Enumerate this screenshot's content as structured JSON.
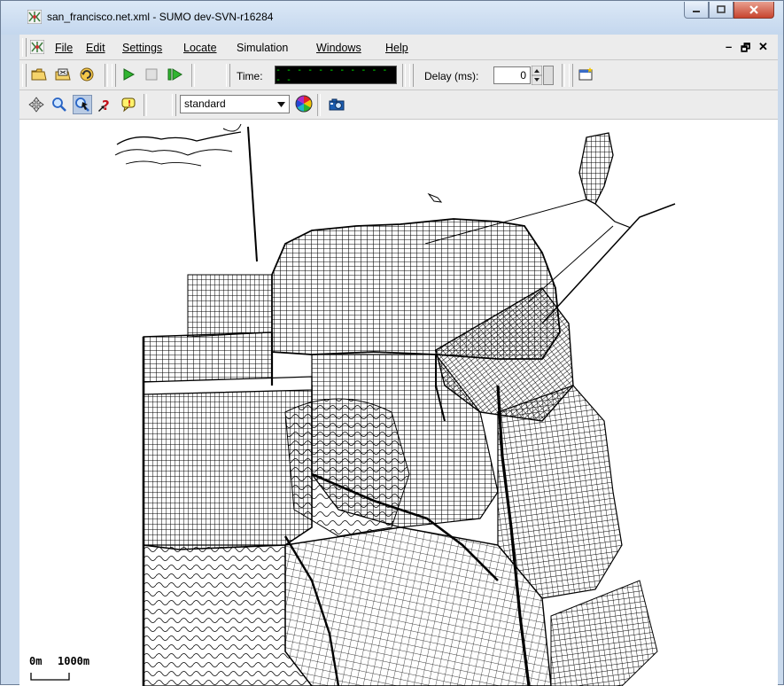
{
  "window": {
    "title": "san_francisco.net.xml - SUMO dev-SVN-r16284",
    "icon": "sumo-app-icon",
    "controls": [
      "minimize-icon",
      "maximize-icon",
      "close-icon"
    ]
  },
  "menubar": {
    "items": [
      {
        "label": "File"
      },
      {
        "label": "Edit"
      },
      {
        "label": "Settings"
      },
      {
        "label": "Locate"
      },
      {
        "label": "Simulation"
      },
      {
        "label": "Windows"
      },
      {
        "label": "Help"
      }
    ],
    "mdi_controls": [
      "–",
      "🗗",
      "✕"
    ]
  },
  "toolbar": {
    "time_label": "Time:",
    "time_value": "- - - - - - - - - - - - -",
    "delay_label": "Delay (ms):",
    "delay_value": "0"
  },
  "view_toolbar": {
    "scheme_value": "standard"
  },
  "canvas": {
    "scale_start": "0m",
    "scale_end": "1000m"
  },
  "colors": {
    "title_gradient_top": "#dbe8f6",
    "close_button": "#c7442f",
    "time_display_bg": "#000000",
    "time_display_fg": "#00ff00",
    "play_green": "#2fb52f",
    "map_lines": "#000000"
  }
}
